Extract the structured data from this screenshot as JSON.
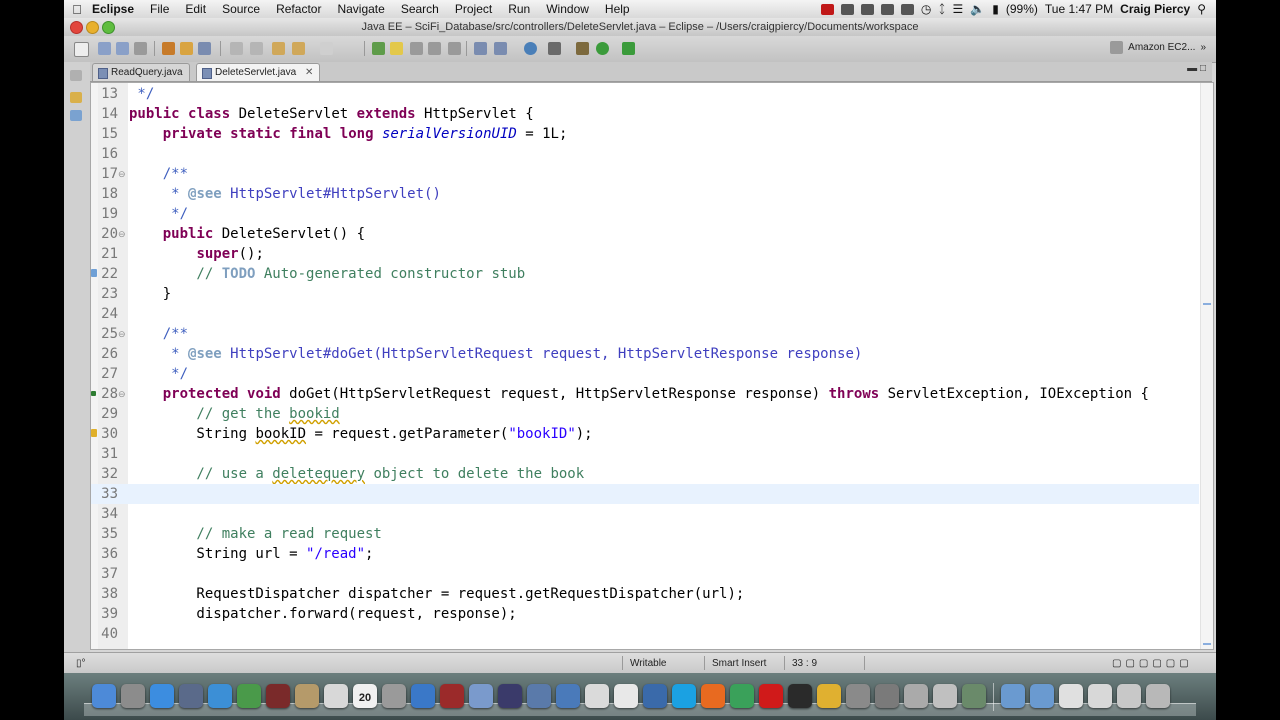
{
  "menubar": {
    "app": "Eclipse",
    "items": [
      "File",
      "Edit",
      "Source",
      "Refactor",
      "Navigate",
      "Search",
      "Project",
      "Run",
      "Window",
      "Help"
    ],
    "battery": "(99%)",
    "clock": "Tue 1:47 PM",
    "user": "Craig Piercy"
  },
  "window": {
    "title": "Java EE – SciFi_Database/src/controllers/DeleteServlet.java – Eclipse – /Users/craigpiercy/Documents/workspace",
    "perspective": "Amazon EC2..."
  },
  "tabs": [
    {
      "label": "ReadQuery.java",
      "active": false
    },
    {
      "label": "DeleteServlet.java",
      "active": true
    }
  ],
  "code_lines": [
    {
      "n": "13",
      "parts": [
        {
          "t": " */",
          "c": "jd"
        }
      ]
    },
    {
      "n": "14",
      "parts": [
        {
          "t": "public",
          "c": "kw"
        },
        {
          "t": " "
        },
        {
          "t": "class",
          "c": "kw"
        },
        {
          "t": " DeleteServlet "
        },
        {
          "t": "extends",
          "c": "kw"
        },
        {
          "t": " HttpServlet {"
        }
      ]
    },
    {
      "n": "15",
      "parts": [
        {
          "t": "    "
        },
        {
          "t": "private",
          "c": "kw"
        },
        {
          "t": " "
        },
        {
          "t": "static",
          "c": "kw"
        },
        {
          "t": " "
        },
        {
          "t": "final",
          "c": "kw"
        },
        {
          "t": " "
        },
        {
          "t": "long",
          "c": "kw"
        },
        {
          "t": " "
        },
        {
          "t": "serialVersionUID",
          "c": "fld"
        },
        {
          "t": " = 1L;"
        }
      ]
    },
    {
      "n": "16",
      "parts": [
        {
          "t": ""
        }
      ]
    },
    {
      "n": "17",
      "fold": "⊖",
      "parts": [
        {
          "t": "    /**",
          "c": "jd"
        }
      ]
    },
    {
      "n": "18",
      "parts": [
        {
          "t": "     * ",
          "c": "jd"
        },
        {
          "t": "@see",
          "c": "jt"
        },
        {
          "t": " HttpServlet#HttpServlet()",
          "c": "jl"
        }
      ]
    },
    {
      "n": "19",
      "parts": [
        {
          "t": "     */",
          "c": "jd"
        }
      ]
    },
    {
      "n": "20",
      "fold": "⊖",
      "parts": [
        {
          "t": "    "
        },
        {
          "t": "public",
          "c": "kw"
        },
        {
          "t": " DeleteServlet() {"
        }
      ]
    },
    {
      "n": "21",
      "parts": [
        {
          "t": "        "
        },
        {
          "t": "super",
          "c": "kw"
        },
        {
          "t": "();"
        }
      ]
    },
    {
      "n": "22",
      "marker": "task",
      "parts": [
        {
          "t": "        // ",
          "c": "cm"
        },
        {
          "t": "TODO",
          "c": "todo"
        },
        {
          "t": " Auto-generated constructor stub",
          "c": "cm"
        }
      ]
    },
    {
      "n": "23",
      "parts": [
        {
          "t": "    }"
        }
      ]
    },
    {
      "n": "24",
      "parts": [
        {
          "t": ""
        }
      ]
    },
    {
      "n": "25",
      "fold": "⊖",
      "parts": [
        {
          "t": "    /**",
          "c": "jd"
        }
      ]
    },
    {
      "n": "26",
      "parts": [
        {
          "t": "     * ",
          "c": "jd"
        },
        {
          "t": "@see",
          "c": "jt"
        },
        {
          "t": " HttpServlet#doGet(HttpServletRequest request, HttpServletResponse response)",
          "c": "jl"
        }
      ]
    },
    {
      "n": "27",
      "parts": [
        {
          "t": "     */",
          "c": "jd"
        }
      ]
    },
    {
      "n": "28",
      "fold": "⊖",
      "marker": "ovr",
      "parts": [
        {
          "t": "    "
        },
        {
          "t": "protected",
          "c": "kw"
        },
        {
          "t": " "
        },
        {
          "t": "void",
          "c": "kw"
        },
        {
          "t": " doGet(HttpServletRequest request, HttpServletResponse response) "
        },
        {
          "t": "throws",
          "c": "kw"
        },
        {
          "t": " ServletException, IOException {"
        }
      ]
    },
    {
      "n": "29",
      "parts": [
        {
          "t": "        // get the ",
          "c": "cm"
        },
        {
          "t": "bookid",
          "c": "cm sq"
        }
      ]
    },
    {
      "n": "30",
      "marker": "warn",
      "parts": [
        {
          "t": "        String "
        },
        {
          "t": "bookID",
          "c": "sq"
        },
        {
          "t": " = request.getParameter("
        },
        {
          "t": "\"bookID\"",
          "c": "st"
        },
        {
          "t": ");"
        }
      ]
    },
    {
      "n": "31",
      "parts": [
        {
          "t": ""
        }
      ]
    },
    {
      "n": "32",
      "parts": [
        {
          "t": "        // use a ",
          "c": "cm"
        },
        {
          "t": "deletequery",
          "c": "cm sq"
        },
        {
          "t": " object to delete the book",
          "c": "cm"
        }
      ]
    },
    {
      "n": "33",
      "current": true,
      "parts": [
        {
          "t": ""
        }
      ]
    },
    {
      "n": "34",
      "parts": [
        {
          "t": ""
        }
      ]
    },
    {
      "n": "35",
      "parts": [
        {
          "t": "        // make a read request",
          "c": "cm"
        }
      ]
    },
    {
      "n": "36",
      "parts": [
        {
          "t": "        String url = "
        },
        {
          "t": "\"/read\"",
          "c": "st"
        },
        {
          "t": ";"
        }
      ]
    },
    {
      "n": "37",
      "parts": [
        {
          "t": ""
        }
      ]
    },
    {
      "n": "38",
      "parts": [
        {
          "t": "        RequestDispatcher dispatcher = request.getRequestDispatcher(url);"
        }
      ]
    },
    {
      "n": "39",
      "parts": [
        {
          "t": "        dispatcher.forward(request, response);"
        }
      ]
    },
    {
      "n": "40",
      "parts": [
        {
          "t": ""
        }
      ]
    }
  ],
  "status": {
    "mode": "Writable",
    "insert": "Smart Insert",
    "position": "33 : 9"
  },
  "dock": {
    "calendar_day": "20"
  },
  "colors": {
    "keyword": "#7f0055",
    "comment": "#3f7f5f",
    "javadoc": "#3f5fbf",
    "string": "#2a00ff",
    "field": "#0000c0",
    "current_line": "#e8f2fe"
  }
}
